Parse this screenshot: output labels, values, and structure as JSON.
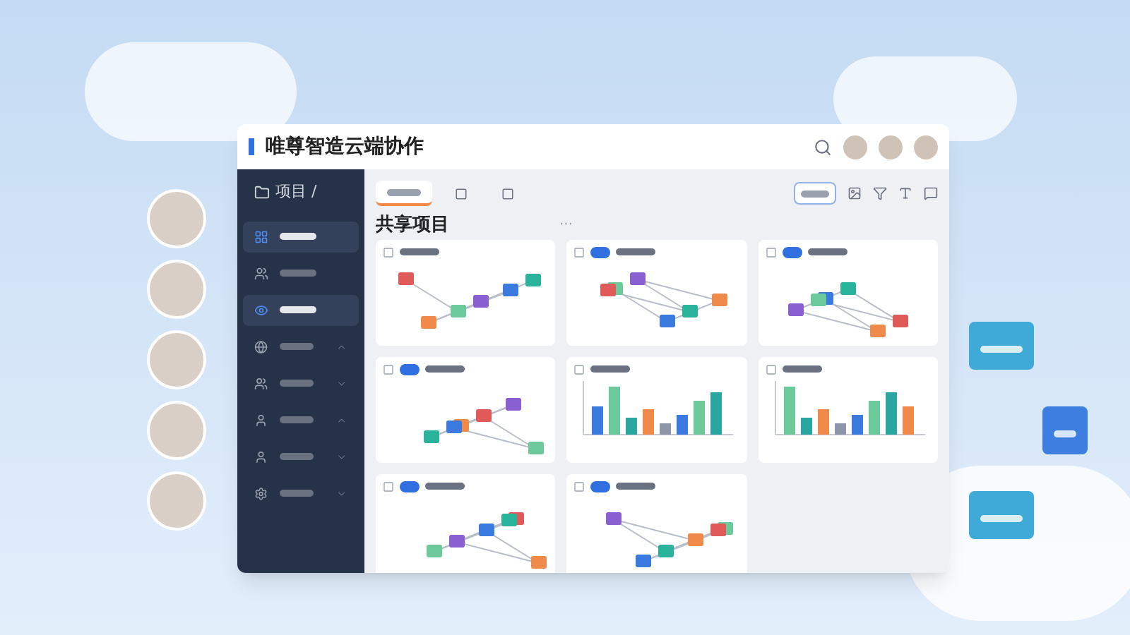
{
  "window": {
    "title": "唯尊智造云端协作"
  },
  "breadcrumb": "项目 /",
  "sidebar": {
    "items": [
      {
        "selected": true
      },
      {
        "selected": false
      },
      {
        "selected": true
      },
      {
        "selected": false
      },
      {
        "selected": false
      },
      {
        "selected": false
      },
      {
        "selected": false
      },
      {
        "selected": false
      }
    ]
  },
  "toolbar": {
    "tabs": [
      {
        "selected": true
      },
      {
        "selected": false
      },
      {
        "selected": false
      }
    ]
  },
  "section": {
    "title": "共享项目",
    "more": "···"
  },
  "cards": [
    {
      "kind": "flow"
    },
    {
      "kind": "flow"
    },
    {
      "kind": "flow"
    },
    {
      "kind": "flow"
    },
    {
      "kind": "chart"
    },
    {
      "kind": "chart"
    },
    {
      "kind": "flow"
    },
    {
      "kind": "flow"
    }
  ]
}
